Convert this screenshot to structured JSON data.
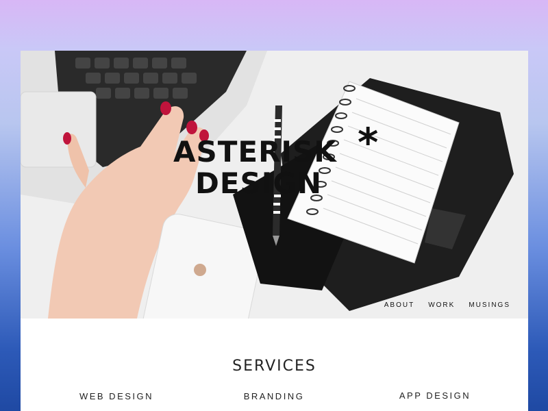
{
  "logo": {
    "line1": "ASTERISK",
    "line2": "DESIGN",
    "mark": "*"
  },
  "nav": {
    "items": [
      {
        "label": "ABOUT"
      },
      {
        "label": "WORK"
      },
      {
        "label": "MUSINGS"
      }
    ]
  },
  "services": {
    "title": "SERVICES",
    "items": [
      {
        "label": "WEB DESIGN"
      },
      {
        "label": "BRANDING"
      },
      {
        "label": "APP DESIGN"
      }
    ]
  },
  "hero_icons": [
    "laptop-keyboard",
    "hand",
    "smartphone",
    "pen",
    "notebook",
    "planner"
  ],
  "colors": {
    "text": "#111111",
    "nail_polish": "#c0143c",
    "gradient_top": "#d8b7f6",
    "gradient_bottom": "#1f49a3"
  }
}
